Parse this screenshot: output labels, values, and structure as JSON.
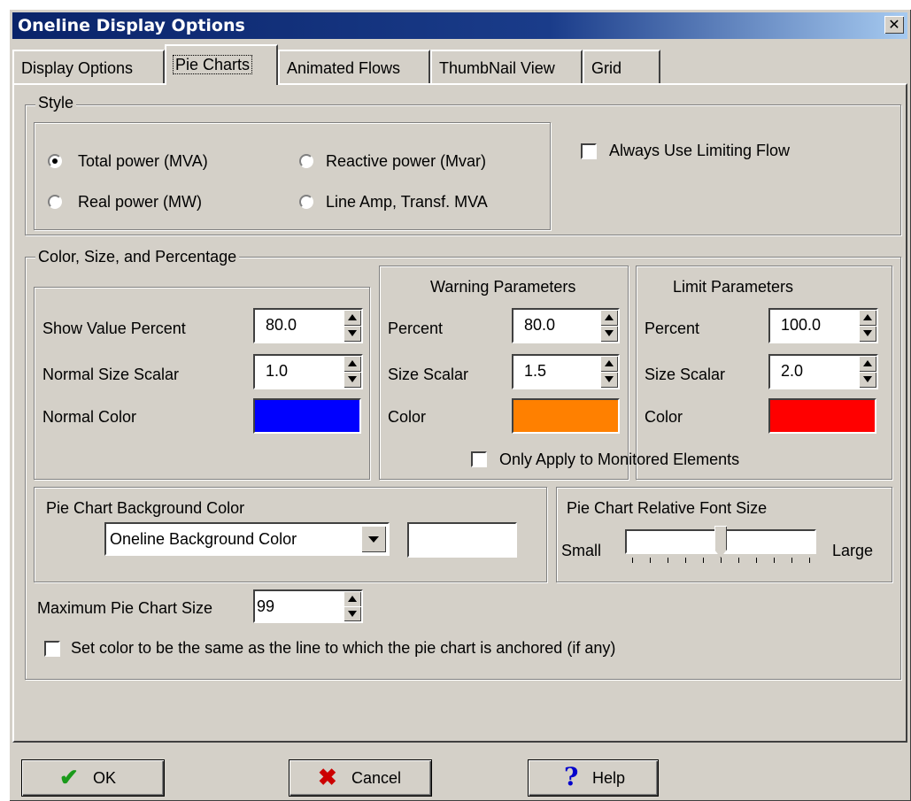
{
  "window": {
    "title": "Oneline Display Options",
    "close_glyph": "✕"
  },
  "tabs": [
    {
      "label": "Display Options"
    },
    {
      "label": "Pie Charts",
      "active": true
    },
    {
      "label": "Animated Flows"
    },
    {
      "label": "ThumbNail View"
    },
    {
      "label": "Grid"
    }
  ],
  "style": {
    "legend": "Style",
    "options": [
      "Total power (MVA)",
      "Reactive power (Mvar)",
      "Real power (MW)",
      "Line Amp, Transf. MVA"
    ],
    "selected": "Total power (MVA)",
    "always_limiting": {
      "label": "Always Use Limiting Flow",
      "checked": false
    }
  },
  "color_size": {
    "legend": "Color, Size, and Percentage",
    "normal": {
      "show_value_percent_label": "Show Value Percent",
      "show_value_percent": "80.0",
      "size_scalar_label": "Normal Size Scalar",
      "size_scalar": "1.0",
      "color_label": "Normal Color",
      "color": "#0000ff"
    },
    "warning": {
      "title": "Warning Parameters",
      "percent_label": "Percent",
      "percent": "80.0",
      "size_scalar_label": "Size Scalar",
      "size_scalar": "1.5",
      "color_label": "Color",
      "color": "#ff8000"
    },
    "limit": {
      "title": "Limit Parameters",
      "percent_label": "Percent",
      "percent": "100.0",
      "size_scalar_label": "Size Scalar",
      "size_scalar": "2.0",
      "color_label": "Color",
      "color": "#ff0000"
    },
    "only_monitored": {
      "label": "Only Apply to Monitored Elements",
      "checked": false
    }
  },
  "background": {
    "title": "Pie Chart Background Color",
    "selected": "Oneline Background Color",
    "color": "#ffffff"
  },
  "font_size": {
    "title": "Pie Chart Relative Font Size",
    "small_label": "Small",
    "large_label": "Large",
    "level": 0.5
  },
  "max_size": {
    "label": "Maximum Pie Chart Size",
    "value": "99"
  },
  "same_color": {
    "label": "Set color to be the same as the line to which the pie chart is anchored (if any)",
    "checked": false
  },
  "buttons": {
    "ok": "OK",
    "cancel": "Cancel",
    "help": "Help"
  }
}
